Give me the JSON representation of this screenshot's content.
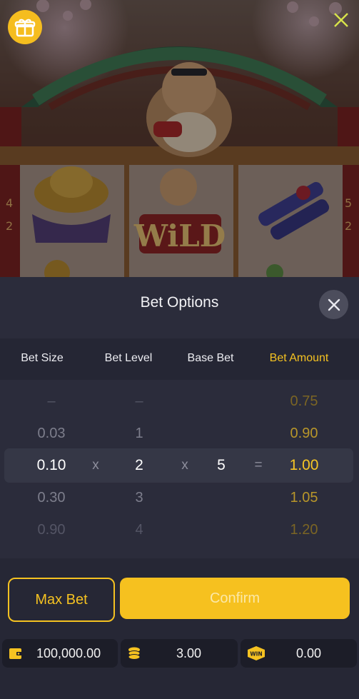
{
  "sheet": {
    "title": "Bet Options",
    "columns": [
      "Bet Size",
      "Bet Level",
      "Base Bet",
      "Bet Amount"
    ]
  },
  "picker": {
    "rows": [
      {
        "size": "–",
        "level": "–",
        "amount": "0.75"
      },
      {
        "size": "0.03",
        "level": "1",
        "amount": "0.90"
      },
      {
        "size": "0.10",
        "level": "2",
        "amount": "1.00"
      },
      {
        "size": "0.30",
        "level": "3",
        "amount": "1.05"
      },
      {
        "size": "0.90",
        "level": "4",
        "amount": "1.20"
      }
    ],
    "base_bet": "5",
    "ops": {
      "times": "x",
      "equals": "="
    }
  },
  "actions": {
    "max_bet_label": "Max Bet",
    "confirm_label": "Confirm"
  },
  "stats": {
    "balance": "100,000.00",
    "bet": "3.00",
    "win": "0.00",
    "win_badge": "WIN"
  },
  "colors": {
    "accent": "#f5c221",
    "sheet_bg": "#2b2c3b",
    "header_bg": "#252634"
  },
  "icons": [
    "gift-icon",
    "close-x-icon",
    "close-icon",
    "wallet-icon",
    "coin-stack-icon",
    "win-badge-icon"
  ]
}
